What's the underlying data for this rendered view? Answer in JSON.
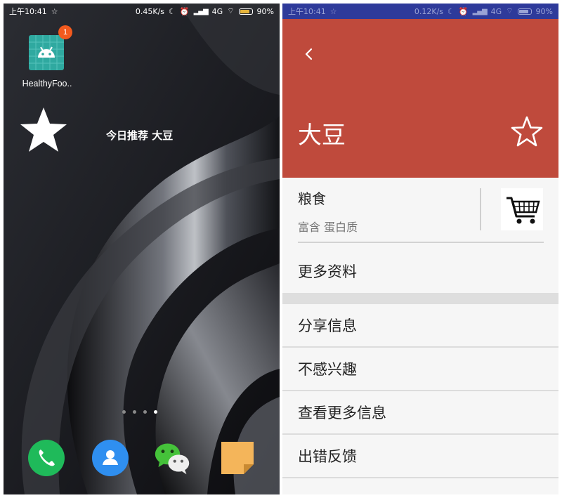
{
  "left": {
    "status": {
      "time": "上午10:41",
      "speed": "0.45K/s",
      "network": "4G",
      "battery": "90%"
    },
    "app": {
      "label": "HealthyFoo..",
      "badge_count": "1"
    },
    "widget": {
      "text": "今日推荐 大豆"
    },
    "page_dots": {
      "count": 4,
      "active": 4
    },
    "dock": [
      "phone-icon",
      "contacts-icon",
      "wechat-icon",
      "notes-icon"
    ]
  },
  "right": {
    "status": {
      "time": "上午10:41",
      "speed": "0.12K/s",
      "network": "4G",
      "battery": "90%"
    },
    "header": {
      "title": "大豆",
      "color": "#bf4a3c"
    },
    "category": {
      "name": "粮食",
      "description": "富含 蛋白质"
    },
    "more_info": "更多资料",
    "menu": [
      "分享信息",
      "不感兴趣",
      "查看更多信息",
      "出错反馈"
    ]
  }
}
